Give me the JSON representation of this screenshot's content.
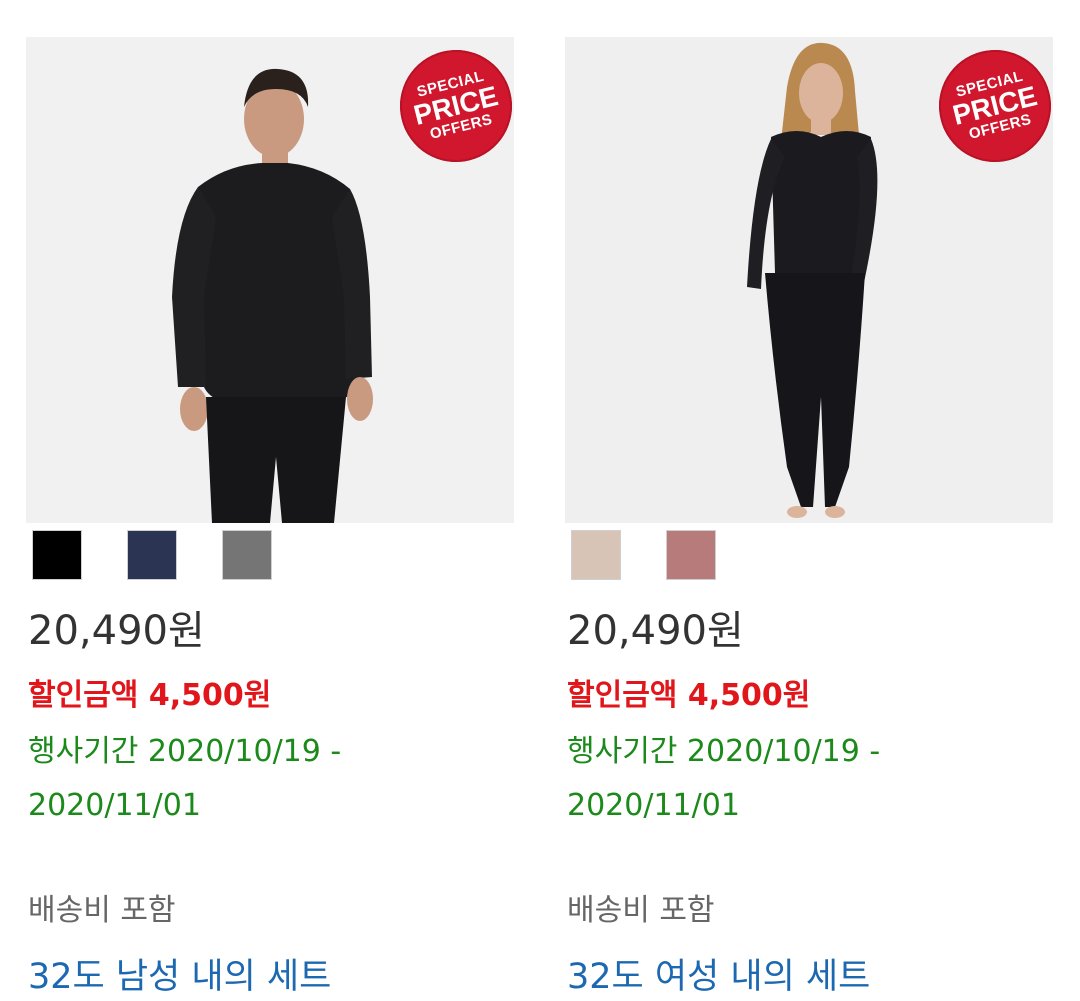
{
  "products": [
    {
      "badge": {
        "line1": "SPECIAL",
        "line2": "PRICE",
        "line3": "OFFERS"
      },
      "swatches": [
        {
          "name": "black",
          "color": "#000000"
        },
        {
          "name": "navy",
          "color": "#2b3553"
        },
        {
          "name": "gray",
          "color": "#757575"
        }
      ],
      "price": "20,490원",
      "discount_label": "할인금액",
      "discount_amount": "4,500원",
      "period_text": "행사기간 2020/10/19 - 2020/11/01",
      "shipping": "배송비 포함",
      "title": "32도 남성 내의 세트"
    },
    {
      "badge": {
        "line1": "SPECIAL",
        "line2": "PRICE",
        "line3": "OFFERS"
      },
      "swatches": [
        {
          "name": "beige",
          "color": "#d8c4b6"
        },
        {
          "name": "rose",
          "color": "#b77b7b"
        }
      ],
      "price": "20,490원",
      "discount_label": "할인금액",
      "discount_amount": "4,500원",
      "period_text": "행사기간 2020/10/19 - 2020/11/01",
      "shipping": "배송비 포함",
      "title": "32도 여성 내의 세트"
    }
  ]
}
